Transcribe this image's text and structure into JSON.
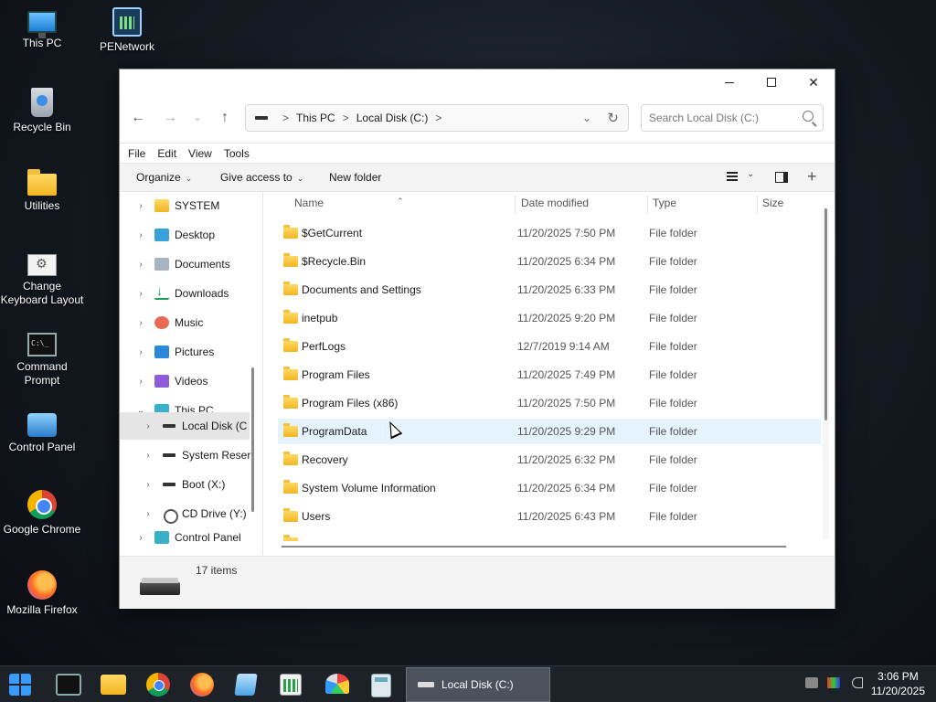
{
  "desktop": {
    "icons": [
      {
        "label": "This PC",
        "icon": "this-pc-icon"
      },
      {
        "label": "PENetwork",
        "icon": "network-icon"
      },
      {
        "label": "Recycle Bin",
        "icon": "recycle-bin-icon"
      },
      {
        "label": "Utilities",
        "icon": "folder-icon"
      },
      {
        "label": "Change Keyboard Layout",
        "icon": "keyboard-settings-icon"
      },
      {
        "label": "Command Prompt",
        "icon": "command-prompt-icon"
      },
      {
        "label": "Control Panel",
        "icon": "control-panel-icon"
      },
      {
        "label": "Google Chrome",
        "icon": "chrome-icon"
      },
      {
        "label": "Mozilla Firefox",
        "icon": "firefox-icon"
      }
    ]
  },
  "window": {
    "address": {
      "segments": [
        "This PC",
        "Local Disk (C:)"
      ],
      "separator": ">"
    },
    "search_placeholder": "Search Local Disk (C:)",
    "menu": [
      "File",
      "Edit",
      "View",
      "Tools"
    ],
    "commands": {
      "organize": "Organize",
      "give_access": "Give access to",
      "new_folder": "New folder"
    },
    "nav_tree": [
      {
        "label": "SYSTEM",
        "icon": "folder-icon",
        "expanded": false
      },
      {
        "label": "Desktop",
        "icon": "desktop-icon",
        "expanded": false
      },
      {
        "label": "Documents",
        "icon": "documents-icon",
        "expanded": false
      },
      {
        "label": "Downloads",
        "icon": "downloads-icon",
        "expanded": false
      },
      {
        "label": "Music",
        "icon": "music-icon",
        "expanded": false
      },
      {
        "label": "Pictures",
        "icon": "pictures-icon",
        "expanded": false
      },
      {
        "label": "Videos",
        "icon": "videos-icon",
        "expanded": false
      },
      {
        "label": "This PC",
        "icon": "this-pc-icon",
        "expanded": true
      },
      {
        "label": "Local Disk (C",
        "icon": "drive-icon",
        "expanded": false,
        "selected": true
      },
      {
        "label": "System Reser",
        "icon": "drive-icon",
        "expanded": false
      },
      {
        "label": "Boot (X:)",
        "icon": "drive-icon",
        "expanded": false
      },
      {
        "label": "CD Drive (Y:)",
        "icon": "cd-drive-icon",
        "expanded": false
      },
      {
        "label": "Control Panel",
        "icon": "control-panel-icon",
        "expanded": false
      }
    ],
    "columns": {
      "name": "Name",
      "date": "Date modified",
      "type": "Type",
      "size": "Size"
    },
    "files": [
      {
        "name": "$GetCurrent",
        "date": "11/20/2025 7:50 PM",
        "type": "File folder"
      },
      {
        "name": "$Recycle.Bin",
        "date": "11/20/2025 6:34 PM",
        "type": "File folder"
      },
      {
        "name": "Documents and Settings",
        "date": "11/20/2025 6:33 PM",
        "type": "File folder"
      },
      {
        "name": "inetpub",
        "date": "11/20/2025 9:20 PM",
        "type": "File folder"
      },
      {
        "name": "PerfLogs",
        "date": "12/7/2019 9:14 AM",
        "type": "File folder"
      },
      {
        "name": "Program Files",
        "date": "11/20/2025 7:49 PM",
        "type": "File folder"
      },
      {
        "name": "Program Files (x86)",
        "date": "11/20/2025 7:50 PM",
        "type": "File folder"
      },
      {
        "name": "ProgramData",
        "date": "11/20/2025 9:29 PM",
        "type": "File folder",
        "hover": true
      },
      {
        "name": "Recovery",
        "date": "11/20/2025 6:32 PM",
        "type": "File folder"
      },
      {
        "name": "System Volume Information",
        "date": "11/20/2025 6:34 PM",
        "type": "File folder"
      },
      {
        "name": "Users",
        "date": "11/20/2025 6:43 PM",
        "type": "File folder"
      }
    ],
    "status": {
      "item_count": "17 items"
    }
  },
  "taskbar": {
    "apps": [
      "start-icon",
      "command-prompt-icon",
      "file-explorer-icon",
      "chrome-icon",
      "firefox-icon",
      "notepad-icon",
      "chart-icon",
      "gauge-icon",
      "calculator-icon"
    ],
    "active_window": "Local Disk (C:)",
    "clock": {
      "time": "3:06 PM",
      "date": "11/20/2025"
    }
  },
  "colors": {
    "accent": "#0067c0",
    "hover_row": "#e5f3ff",
    "taskbar": "#1d2229"
  }
}
